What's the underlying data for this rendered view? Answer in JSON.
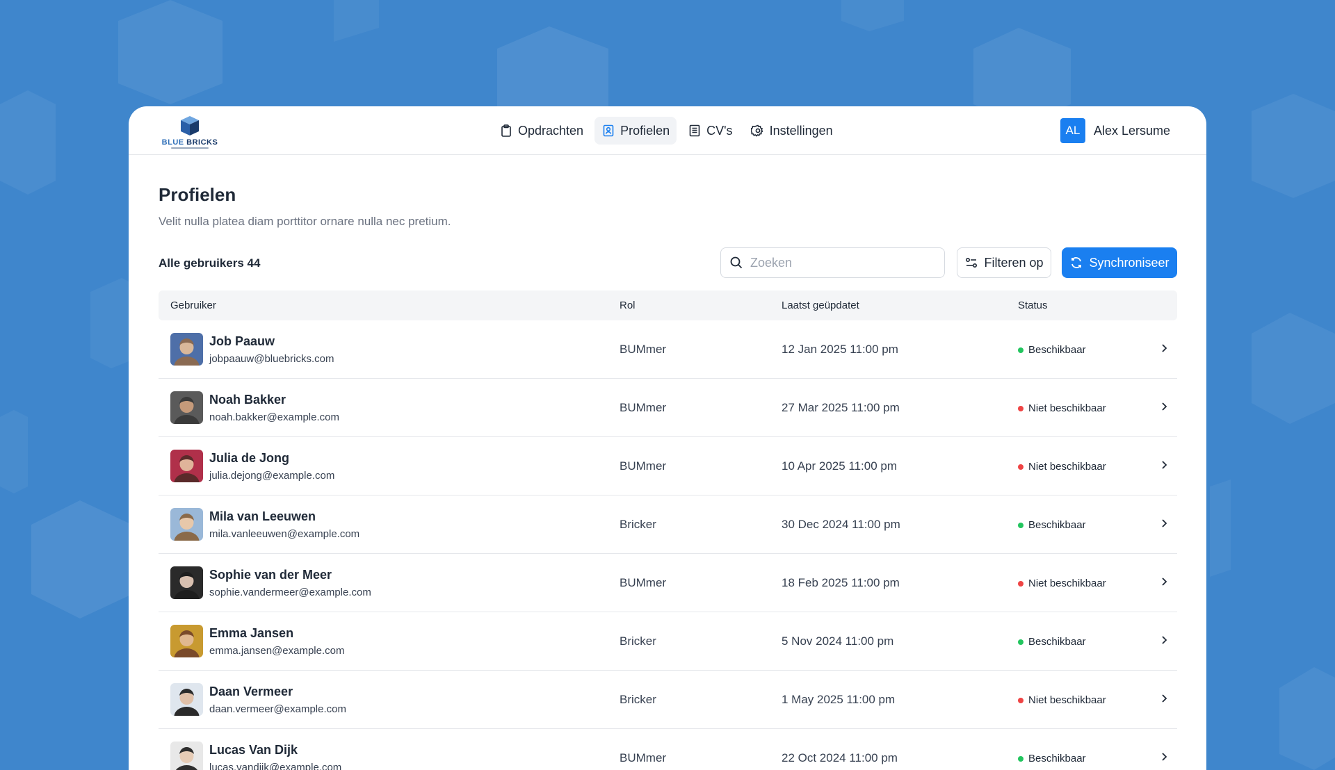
{
  "brand": {
    "logo_word1": "BLUE",
    "logo_word2": "BRICKS"
  },
  "nav": [
    {
      "label": "Opdrachten",
      "icon": "clipboard-icon",
      "active": false
    },
    {
      "label": "Profielen",
      "icon": "contact-card-icon",
      "active": true
    },
    {
      "label": "CV's",
      "icon": "document-icon",
      "active": false
    },
    {
      "label": "Instellingen",
      "icon": "gear-icon",
      "active": false
    }
  ],
  "user": {
    "initials": "AL",
    "name": "Alex Lersume"
  },
  "page": {
    "title": "Profielen",
    "subtitle": "Velit nulla platea diam porttitor ornare nulla nec pretium.",
    "count_label": "Alle gebruikers 44"
  },
  "toolbar": {
    "search_placeholder": "Zoeken",
    "filter_label": "Filteren op",
    "sync_label": "Synchroniseer"
  },
  "table": {
    "headers": [
      "Gebruiker",
      "Rol",
      "Laatst geüpdatet",
      "Status"
    ],
    "rows": [
      {
        "name": "Job Paauw",
        "email": "jobpaauw@bluebricks.com",
        "rol": "BUMmer",
        "date": "12 Jan 2025 11:00 pm",
        "status": "Beschikbaar",
        "available": true
      },
      {
        "name": "Noah Bakker",
        "email": "noah.bakker@example.com",
        "rol": "BUMmer",
        "date": "27 Mar 2025 11:00 pm",
        "status": "Niet beschikbaar",
        "available": false
      },
      {
        "name": "Julia de Jong",
        "email": "julia.dejong@example.com",
        "rol": "BUMmer",
        "date": "10 Apr 2025 11:00 pm",
        "status": "Niet beschikbaar",
        "available": false
      },
      {
        "name": "Mila van Leeuwen",
        "email": "mila.vanleeuwen@example.com",
        "rol": "Bricker",
        "date": "30 Dec 2024 11:00 pm",
        "status": "Beschikbaar",
        "available": true
      },
      {
        "name": "Sophie van der Meer",
        "email": "sophie.vandermeer@example.com",
        "rol": "BUMmer",
        "date": "18 Feb 2025 11:00 pm",
        "status": "Niet beschikbaar",
        "available": false
      },
      {
        "name": "Emma Jansen",
        "email": "emma.jansen@example.com",
        "rol": "Bricker",
        "date": "5 Nov 2024 11:00 pm",
        "status": "Beschikbaar",
        "available": true
      },
      {
        "name": "Daan Vermeer",
        "email": "daan.vermeer@example.com",
        "rol": "Bricker",
        "date": "1 May 2025 11:00 pm",
        "status": "Niet beschikbaar",
        "available": false
      },
      {
        "name": "Lucas Van Dijk",
        "email": "lucas.vandijk@example.com",
        "rol": "BUMmer",
        "date": "22 Oct 2024 11:00 pm",
        "status": "Beschikbaar",
        "available": true
      }
    ]
  },
  "colors": {
    "background": "#3f86cc",
    "accent": "#1a7ff0",
    "available": "#22c55e",
    "unavailable": "#ef4444"
  }
}
